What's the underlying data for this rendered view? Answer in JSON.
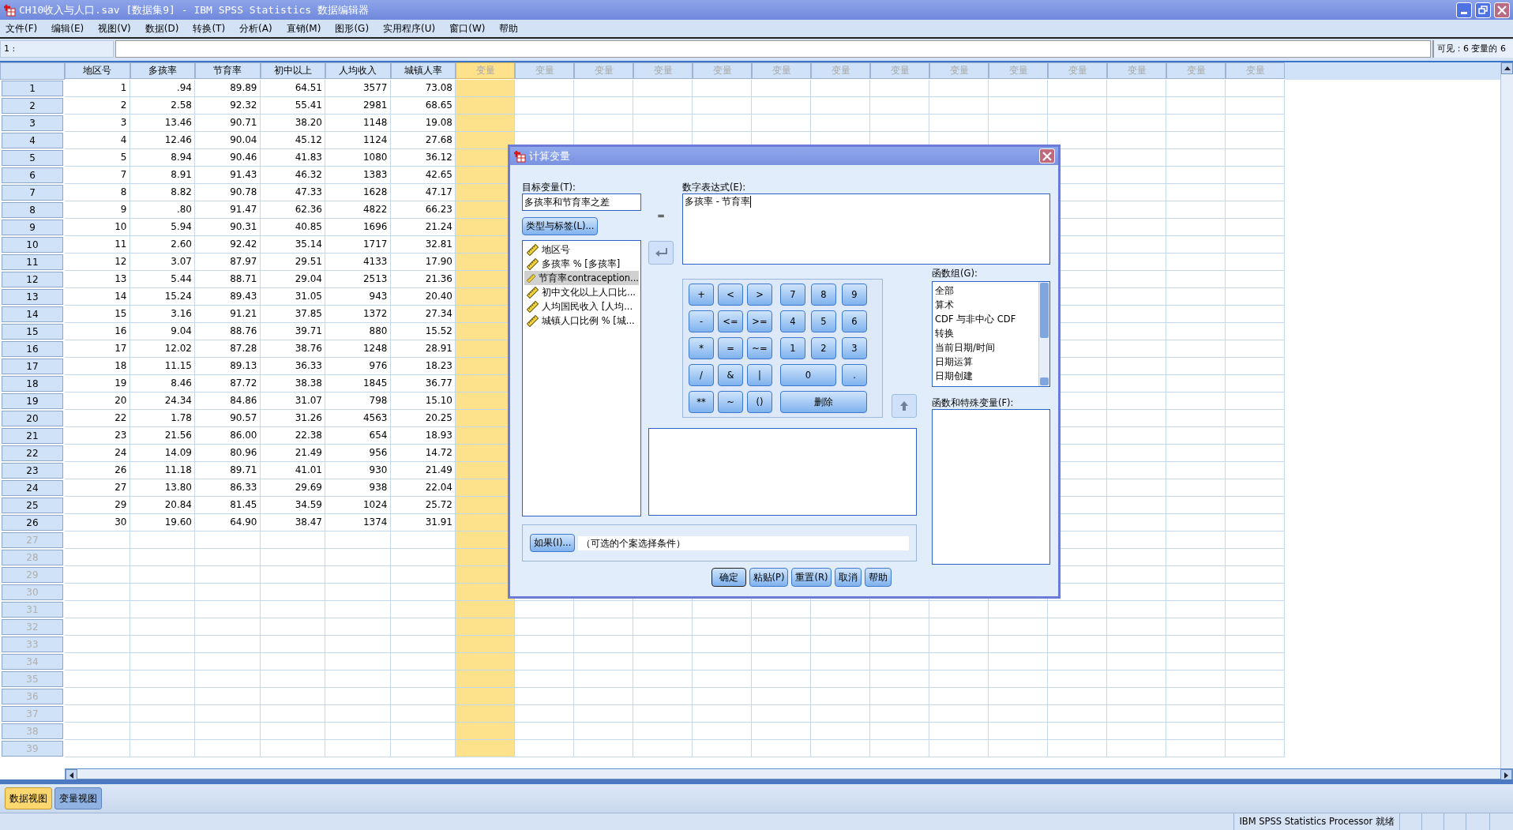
{
  "window": {
    "title": "CH10收入与人口.sav [数据集9] - IBM SPSS Statistics 数据编辑器"
  },
  "menu": [
    "文件(F)",
    "编辑(E)",
    "视图(V)",
    "数据(D)",
    "转换(T)",
    "分析(A)",
    "直销(M)",
    "图形(G)",
    "实用程序(U)",
    "窗口(W)",
    "帮助"
  ],
  "cell_editor": {
    "cell": "1 :",
    "visible_info": "可见：6 变量的 6"
  },
  "grid": {
    "columns": [
      {
        "label": "地区号",
        "kind": "data",
        "selected": false
      },
      {
        "label": "多孩率",
        "kind": "data",
        "selected": false
      },
      {
        "label": "节育率",
        "kind": "data",
        "selected": false
      },
      {
        "label": "初中以上",
        "kind": "data",
        "selected": false
      },
      {
        "label": "人均收入",
        "kind": "data",
        "selected": false
      },
      {
        "label": "城镇人率",
        "kind": "data",
        "selected": false
      },
      {
        "label": "变量",
        "kind": "empty",
        "selected": true
      },
      {
        "label": "变量",
        "kind": "empty",
        "selected": false
      },
      {
        "label": "变量",
        "kind": "empty",
        "selected": false
      },
      {
        "label": "变量",
        "kind": "empty",
        "selected": false
      },
      {
        "label": "变量",
        "kind": "empty",
        "selected": false
      },
      {
        "label": "变量",
        "kind": "empty",
        "selected": false
      },
      {
        "label": "变量",
        "kind": "empty",
        "selected": false
      },
      {
        "label": "变量",
        "kind": "empty",
        "selected": false
      },
      {
        "label": "变量",
        "kind": "empty",
        "selected": false
      },
      {
        "label": "变量",
        "kind": "empty",
        "selected": false
      },
      {
        "label": "变量",
        "kind": "empty",
        "selected": false
      },
      {
        "label": "变量",
        "kind": "empty",
        "selected": false
      },
      {
        "label": "变量",
        "kind": "empty",
        "selected": false
      },
      {
        "label": "变量",
        "kind": "empty",
        "selected": false
      }
    ],
    "rows": [
      {
        "label": "1",
        "cells": [
          "1",
          ".94",
          "89.89",
          "64.51",
          "3577",
          "73.08"
        ]
      },
      {
        "label": "2",
        "cells": [
          "2",
          "2.58",
          "92.32",
          "55.41",
          "2981",
          "68.65"
        ]
      },
      {
        "label": "3",
        "cells": [
          "3",
          "13.46",
          "90.71",
          "38.20",
          "1148",
          "19.08"
        ]
      },
      {
        "label": "4",
        "cells": [
          "4",
          "12.46",
          "90.04",
          "45.12",
          "1124",
          "27.68"
        ]
      },
      {
        "label": "5",
        "cells": [
          "5",
          "8.94",
          "90.46",
          "41.83",
          "1080",
          "36.12"
        ]
      },
      {
        "label": "6",
        "cells": [
          "7",
          "8.91",
          "91.43",
          "46.32",
          "1383",
          "42.65"
        ]
      },
      {
        "label": "7",
        "cells": [
          "8",
          "8.82",
          "90.78",
          "47.33",
          "1628",
          "47.17"
        ]
      },
      {
        "label": "8",
        "cells": [
          "9",
          ".80",
          "91.47",
          "62.36",
          "4822",
          "66.23"
        ]
      },
      {
        "label": "9",
        "cells": [
          "10",
          "5.94",
          "90.31",
          "40.85",
          "1696",
          "21.24"
        ]
      },
      {
        "label": "10",
        "cells": [
          "11",
          "2.60",
          "92.42",
          "35.14",
          "1717",
          "32.81"
        ]
      },
      {
        "label": "11",
        "cells": [
          "12",
          "3.07",
          "87.97",
          "29.51",
          "4133",
          "17.90"
        ]
      },
      {
        "label": "12",
        "cells": [
          "13",
          "5.44",
          "88.71",
          "29.04",
          "2513",
          "21.36"
        ]
      },
      {
        "label": "13",
        "cells": [
          "14",
          "15.24",
          "89.43",
          "31.05",
          "943",
          "20.40"
        ]
      },
      {
        "label": "14",
        "cells": [
          "15",
          "3.16",
          "91.21",
          "37.85",
          "1372",
          "27.34"
        ]
      },
      {
        "label": "15",
        "cells": [
          "16",
          "9.04",
          "88.76",
          "39.71",
          "880",
          "15.52"
        ]
      },
      {
        "label": "16",
        "cells": [
          "17",
          "12.02",
          "87.28",
          "38.76",
          "1248",
          "28.91"
        ]
      },
      {
        "label": "17",
        "cells": [
          "18",
          "11.15",
          "89.13",
          "36.33",
          "976",
          "18.23"
        ]
      },
      {
        "label": "18",
        "cells": [
          "19",
          "8.46",
          "87.72",
          "38.38",
          "1845",
          "36.77"
        ]
      },
      {
        "label": "19",
        "cells": [
          "20",
          "24.34",
          "84.86",
          "31.07",
          "798",
          "15.10"
        ]
      },
      {
        "label": "20",
        "cells": [
          "22",
          "1.78",
          "90.57",
          "31.26",
          "4563",
          "20.25"
        ]
      },
      {
        "label": "21",
        "cells": [
          "23",
          "21.56",
          "86.00",
          "22.38",
          "654",
          "18.93"
        ]
      },
      {
        "label": "22",
        "cells": [
          "24",
          "14.09",
          "80.96",
          "21.49",
          "956",
          "14.72"
        ]
      },
      {
        "label": "23",
        "cells": [
          "26",
          "11.18",
          "89.71",
          "41.01",
          "930",
          "21.49"
        ]
      },
      {
        "label": "24",
        "cells": [
          "27",
          "13.80",
          "86.33",
          "29.69",
          "938",
          "22.04"
        ]
      },
      {
        "label": "25",
        "cells": [
          "29",
          "20.84",
          "81.45",
          "34.59",
          "1024",
          "25.72"
        ]
      },
      {
        "label": "26",
        "cells": [
          "30",
          "19.60",
          "64.90",
          "38.47",
          "1374",
          "31.91"
        ]
      },
      {
        "label": "27"
      },
      {
        "label": "28"
      },
      {
        "label": "29"
      },
      {
        "label": "30"
      },
      {
        "label": "31"
      },
      {
        "label": "32"
      },
      {
        "label": "33"
      },
      {
        "label": "34"
      },
      {
        "label": "35"
      },
      {
        "label": "36"
      },
      {
        "label": "37"
      },
      {
        "label": "38"
      },
      {
        "label": "39"
      }
    ]
  },
  "dialog": {
    "title": "计算变量",
    "target_label": "目标变量(T):",
    "target_value": "多孩率和节育率之差",
    "equals": "=",
    "type_label_button": "类型与标签(L)...",
    "variables": [
      {
        "label": "地区号",
        "selected": false
      },
      {
        "label": "多孩率 % [多孩率]",
        "selected": false
      },
      {
        "label": "节育率contraception...",
        "selected": true
      },
      {
        "label": "初中文化以上人口比...",
        "selected": false
      },
      {
        "label": "人均国民收入 [人均...",
        "selected": false
      },
      {
        "label": "城镇人口比例 % [城...",
        "selected": false
      }
    ],
    "expression_label": "数字表达式(E):",
    "expression_value": "多孩率 - 节育率",
    "operators": [
      [
        "+",
        "<",
        ">"
      ],
      [
        "-",
        "<=",
        ">="
      ],
      [
        "*",
        "=",
        "~="
      ],
      [
        "/",
        "&",
        "|"
      ],
      [
        "**",
        "~",
        "()"
      ]
    ],
    "digits": [
      {
        "label": "7",
        "kind": "single"
      },
      {
        "label": "8",
        "kind": "single"
      },
      {
        "label": "9",
        "kind": "single"
      },
      {
        "label": "4",
        "kind": "single"
      },
      {
        "label": "5",
        "kind": "single"
      },
      {
        "label": "6",
        "kind": "single"
      },
      {
        "label": "1",
        "kind": "single"
      },
      {
        "label": "2",
        "kind": "single"
      },
      {
        "label": "3",
        "kind": "single"
      },
      {
        "label": "0",
        "kind": "double"
      },
      {
        "label": ".",
        "kind": "single"
      },
      {
        "label": "删除",
        "kind": "triple"
      }
    ],
    "function_groups": {
      "label": "函数组(G):",
      "items": [
        "全部",
        "算术",
        "CDF 与非中心 CDF",
        "转换",
        "当前日期/时间",
        "日期运算",
        "日期创建"
      ]
    },
    "functions_label": "函数和特殊变量(F):",
    "if_button": "如果(I)...",
    "if_hint": "（可选的个案选择条件）",
    "buttons": [
      {
        "label": "确定",
        "default": true
      },
      {
        "label": "粘贴(P)",
        "default": false
      },
      {
        "label": "重置(R)",
        "default": false
      },
      {
        "label": "取消",
        "default": false
      },
      {
        "label": "帮助",
        "default": false
      }
    ]
  },
  "view_tabs": [
    {
      "label": "数据视图",
      "selected": true
    },
    {
      "label": "变量视图",
      "selected": false
    }
  ],
  "status_bar": {
    "text": "IBM SPSS Statistics Processor 就绪"
  }
}
